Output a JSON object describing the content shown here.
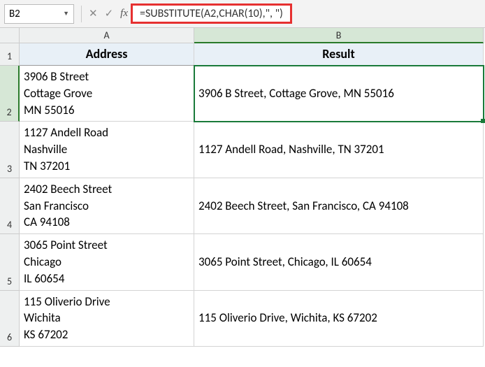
{
  "name_box": "B2",
  "formula": "=SUBSTITUTE(A2,CHAR(10),\", \")",
  "columns": [
    "A",
    "B"
  ],
  "headers": {
    "A": "Address",
    "B": "Result"
  },
  "chart_data": {
    "type": "table",
    "columns": [
      "Address",
      "Result"
    ],
    "rows": [
      {
        "address_lines": [
          "3906 B Street",
          "Cottage Grove",
          "MN 55016"
        ],
        "result": "3906 B Street, Cottage Grove, MN 55016"
      },
      {
        "address_lines": [
          "1127 Andell Road",
          "Nashville",
          "TN 37201"
        ],
        "result": "1127 Andell Road, Nashville, TN 37201"
      },
      {
        "address_lines": [
          "2402 Beech Street",
          "San Francisco",
          "CA 94108"
        ],
        "result": "2402 Beech Street, San Francisco, CA 94108"
      },
      {
        "address_lines": [
          "3065 Point Street",
          "Chicago",
          "IL 60654"
        ],
        "result": "3065 Point Street, Chicago, IL 60654"
      },
      {
        "address_lines": [
          "115 Oliverio Drive",
          "Wichita",
          "KS 67202"
        ],
        "result": "115 Oliverio Drive, Wichita, KS 67202"
      }
    ]
  },
  "selected_cell": "B2"
}
